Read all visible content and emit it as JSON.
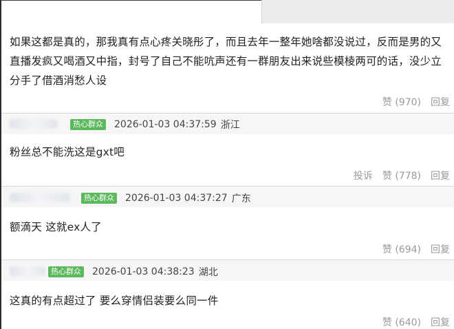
{
  "comments": [
    {
      "text_lines": [
        "如果这都是真的，那我真有点心疼关晓彤了，而且去年一整年她啥都没说过，反而是男的又",
        "直播发疯又喝酒又中指，封号了自己不能吭声还有一群朋友出来说些模棱两可的话，没少立",
        "分手了借酒消愁人设"
      ],
      "likes_label": "赞 (970)",
      "reply_label": "回复"
    },
    {
      "badge": "热心群众",
      "timestamp": "2026-01-03 04:37:59",
      "location": "浙江",
      "text": "粉丝总不能洗这是gxt吧",
      "report_label": "投诉",
      "likes_label": "赞 (778)",
      "reply_label": "回复"
    },
    {
      "badge": "热心群众",
      "timestamp": "2026-01-03 04:37:27",
      "location": "广东",
      "text": "额滴天 这就ex人了",
      "likes_label": "赞 (694)",
      "reply_label": "回复"
    },
    {
      "badge": "热心群众",
      "timestamp": "2026-01-03 04:38:23",
      "location": "湖北",
      "text": "这真的有点超过了 要么穿情侣装要么同一件",
      "likes_label": "赞 (640)",
      "reply_label": "回复"
    }
  ]
}
